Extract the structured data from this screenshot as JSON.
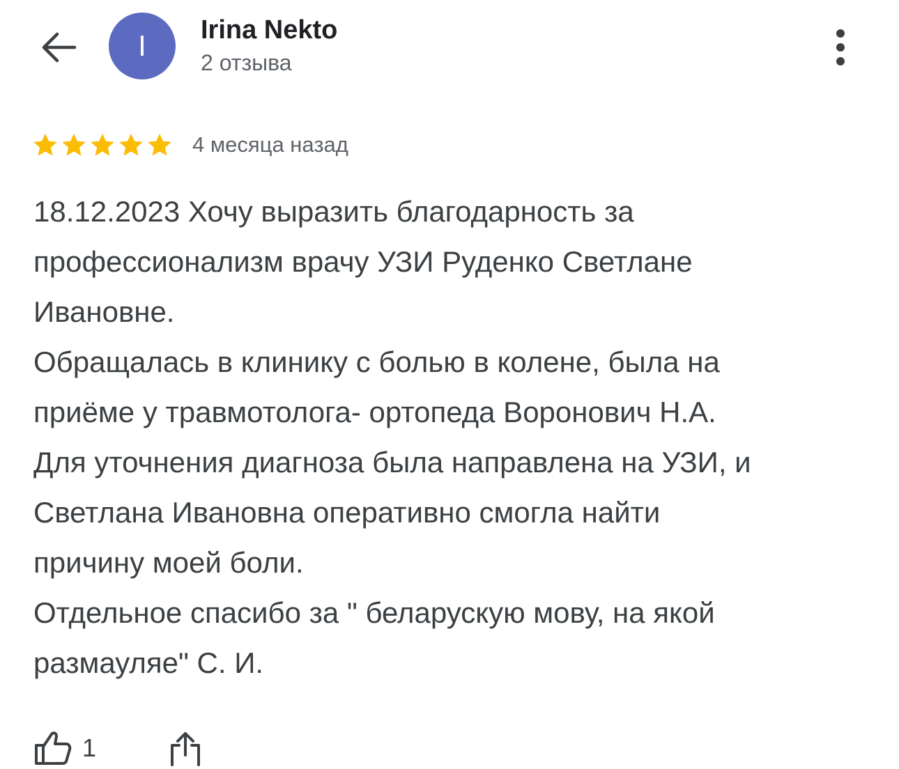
{
  "header": {
    "user_name": "Irina Nekto",
    "review_count": "2 отзыва",
    "avatar_letter": "I",
    "avatar_color": "#5c6bc0",
    "back_icon": "arrow-back-icon",
    "menu_icon": "more-vert-icon"
  },
  "review": {
    "rating": 5,
    "max_rating": 5,
    "star_color": "#fbbc04",
    "date": "4 месяца назад",
    "lines": [
      "18.12.2023 Хочу выразить благодарность за",
      "профессионализм врачу УЗИ Руденко Светлане",
      "Ивановне.",
      "Обращалась в клинику с болью в колене, была на",
      "приёме у травмотолога- ортопеда Воронович Н.А.",
      "Для уточнения диагноза была направлена на УЗИ, и",
      "Светлана Ивановна оперативно смогла найти",
      "причину моей боли.",
      "Отдельное спасибо за \" беларускую мову, на якой",
      "размауляе\" С. И."
    ]
  },
  "actions": {
    "like_count": "1",
    "like_icon": "thumb-up-icon",
    "share_icon": "share-icon"
  }
}
